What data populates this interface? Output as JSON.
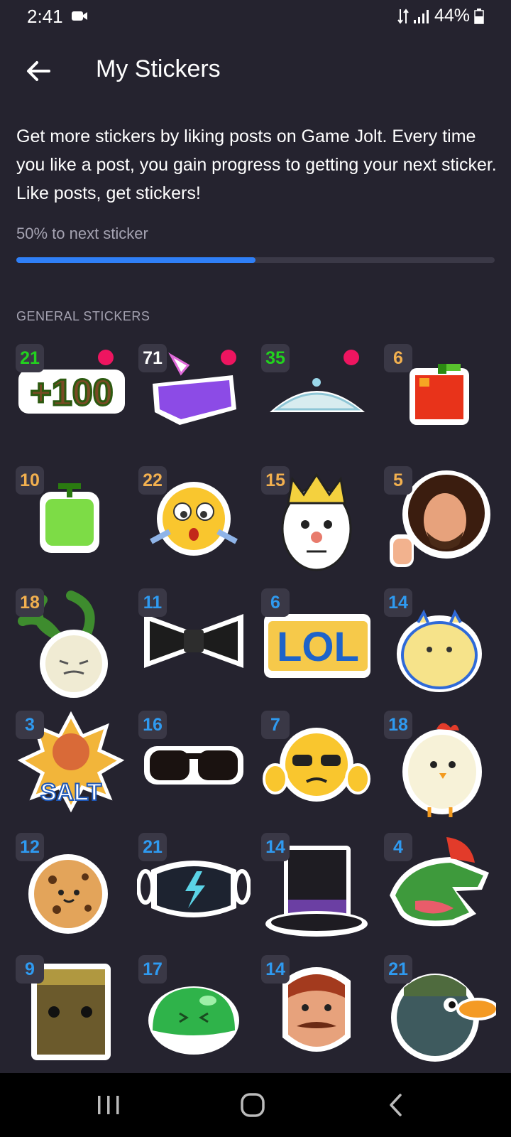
{
  "status": {
    "time": "2:41",
    "battery": "44%"
  },
  "app_bar": {
    "title": "My Stickers"
  },
  "description": "Get more stickers by liking posts on Game Jolt. Every time you like a post, you gain progress to getting your next sticker. Like posts, get stickers!",
  "progress": {
    "label": "50% to next sticker",
    "value": 0.5
  },
  "section": {
    "label": "GENERAL STICKERS"
  },
  "colors": {
    "background": "#25232f",
    "progress": "#2f7ff7",
    "new_dot": "#ee1560",
    "green": "#22d21e",
    "orange": "#f2b04f",
    "blue": "#2f9af0",
    "white": "#ffffff"
  },
  "stickers": [
    {
      "count": "21",
      "name": "plus-100",
      "color": "#22d21e",
      "new": true
    },
    {
      "count": "71",
      "name": "purple-fist",
      "color": "#ffffff",
      "new": true
    },
    {
      "count": "35",
      "name": "tiara",
      "color": "#22d21e",
      "new": true
    },
    {
      "count": "6",
      "name": "pixel-apple",
      "color": "#f2b04f",
      "new": false
    },
    {
      "count": "10",
      "name": "pixel-melon",
      "color": "#f2b04f",
      "new": false
    },
    {
      "count": "22",
      "name": "worried-emoji",
      "color": "#f2b04f",
      "new": false
    },
    {
      "count": "15",
      "name": "crowned-king",
      "color": "#f2b04f",
      "new": false
    },
    {
      "count": "5",
      "name": "painter-thumbs-up",
      "color": "#f2b04f",
      "new": false
    },
    {
      "count": "18",
      "name": "turnip",
      "color": "#f2b04f",
      "new": false
    },
    {
      "count": "11",
      "name": "bow-tie",
      "color": "#2f9af0",
      "new": false
    },
    {
      "count": "6",
      "name": "lol-text",
      "color": "#2f9af0",
      "new": false
    },
    {
      "count": "14",
      "name": "fluffy-bun",
      "color": "#2f9af0",
      "new": false
    },
    {
      "count": "3",
      "name": "salt-guy",
      "color": "#2f9af0",
      "new": false
    },
    {
      "count": "16",
      "name": "sunglasses",
      "color": "#2f9af0",
      "new": false
    },
    {
      "count": "7",
      "name": "sunglasses-emoji",
      "color": "#2f9af0",
      "new": false
    },
    {
      "count": "18",
      "name": "chick",
      "color": "#2f9af0",
      "new": false
    },
    {
      "count": "12",
      "name": "cookie",
      "color": "#2f9af0",
      "new": false
    },
    {
      "count": "21",
      "name": "face-mask",
      "color": "#2f9af0",
      "new": false
    },
    {
      "count": "14",
      "name": "top-hat",
      "color": "#2f9af0",
      "new": false
    },
    {
      "count": "4",
      "name": "crocodile",
      "color": "#2f9af0",
      "new": false
    },
    {
      "count": "9",
      "name": "paper-bag",
      "color": "#2f9af0",
      "new": false
    },
    {
      "count": "17",
      "name": "green-slime",
      "color": "#2f9af0",
      "new": false
    },
    {
      "count": "14",
      "name": "mustache-neighbor",
      "color": "#2f9af0",
      "new": false
    },
    {
      "count": "21",
      "name": "soldier-duck",
      "color": "#2f9af0",
      "new": false
    }
  ]
}
